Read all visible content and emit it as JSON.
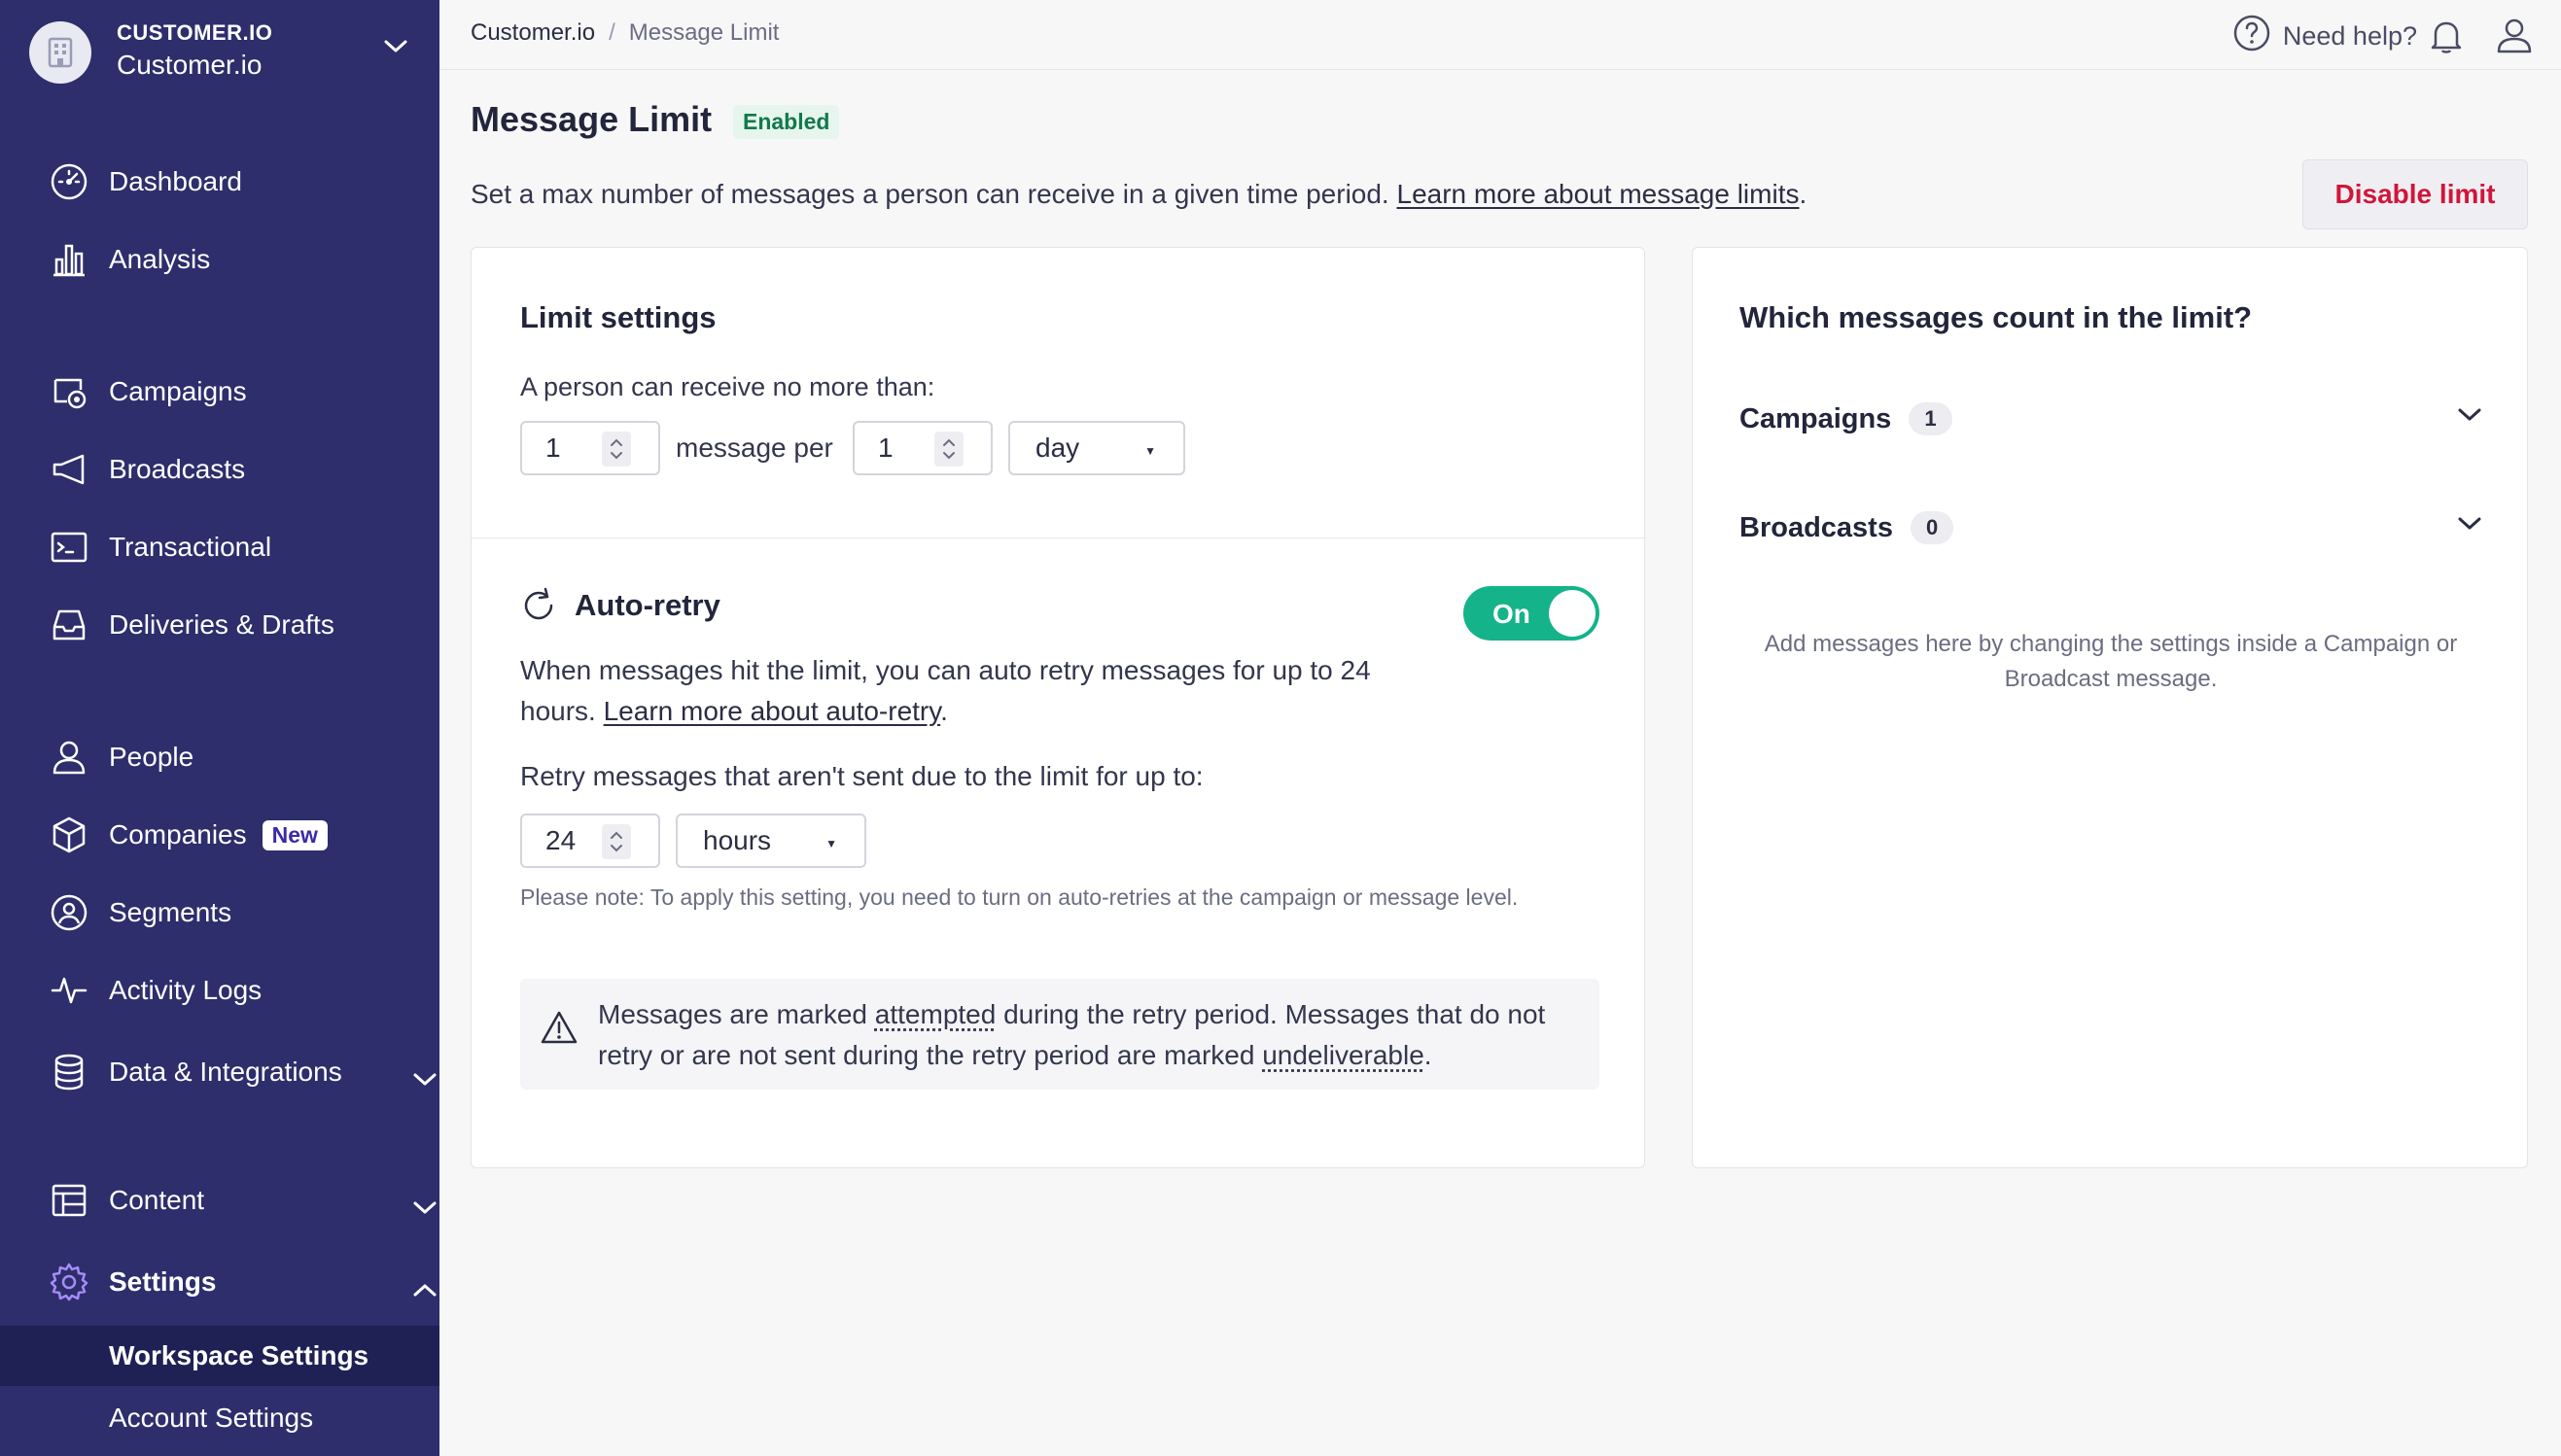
{
  "workspace": {
    "org": "CUSTOMER.IO",
    "name": "Customer.io"
  },
  "sidebar": {
    "items": [
      {
        "label": "Dashboard",
        "icon": "dashboard-icon"
      },
      {
        "label": "Analysis",
        "icon": "bar-chart-icon"
      },
      {
        "label": "Campaigns",
        "icon": "campaigns-icon"
      },
      {
        "label": "Broadcasts",
        "icon": "megaphone-icon"
      },
      {
        "label": "Transactional",
        "icon": "terminal-icon"
      },
      {
        "label": "Deliveries & Drafts",
        "icon": "inbox-icon"
      },
      {
        "label": "People",
        "icon": "person-icon"
      },
      {
        "label": "Companies",
        "icon": "cube-icon",
        "badge": "New"
      },
      {
        "label": "Segments",
        "icon": "segments-icon"
      },
      {
        "label": "Activity Logs",
        "icon": "pulse-icon"
      },
      {
        "label": "Data & Integrations",
        "icon": "database-icon"
      },
      {
        "label": "Content",
        "icon": "layout-icon"
      },
      {
        "label": "Settings",
        "icon": "gear-icon"
      }
    ],
    "settings_sub": [
      {
        "label": "Workspace Settings"
      },
      {
        "label": "Account Settings"
      }
    ]
  },
  "topbar": {
    "breadcrumb": [
      "Customer.io",
      "Message Limit"
    ],
    "help_label": "Need help?"
  },
  "page": {
    "title": "Message Limit",
    "status": "Enabled",
    "description": "Set a max number of messages a person can receive in a given time period. ",
    "description_link": "Learn more about message limits",
    "description_end": ".",
    "disable_button": "Disable limit"
  },
  "limit_settings": {
    "title": "Limit settings",
    "prompt": "A person can receive no more than:",
    "count_value": "1",
    "per_label": "message per",
    "period_value": "1",
    "unit_value": "day"
  },
  "auto_retry": {
    "title": "Auto-retry",
    "toggle_label": "On",
    "toggle_state": "on",
    "desc_line1": "When messages hit the limit, you can auto retry messages for up to 24",
    "desc_line2": "hours. ",
    "desc_link": "Learn more about auto-retry",
    "desc_end": ".",
    "retry_prompt": "Retry messages that aren't sent due to the limit for up to:",
    "retry_value": "24",
    "retry_unit": "hours",
    "note": "Please note: To apply this setting, you need to turn on auto-retries at the campaign or message level.",
    "callout_part1": "Messages are marked ",
    "callout_term1": "attempted",
    "callout_part2": " during the retry period. Messages that do not retry or are not sent during the retry period are marked ",
    "callout_term2": "undeliverable",
    "callout_end": "."
  },
  "right_panel": {
    "title": "Which messages count in the limit?",
    "groups": [
      {
        "label": "Campaigns",
        "count": "1"
      },
      {
        "label": "Broadcasts",
        "count": "0"
      }
    ],
    "hint": "Add messages here by changing the settings inside a Campaign or Broadcast message."
  },
  "colors": {
    "sidebar_bg": "#2d2e6b",
    "accent_green": "#15b389",
    "danger_red": "#d1153a",
    "settings_icon": "#a78bfa"
  }
}
